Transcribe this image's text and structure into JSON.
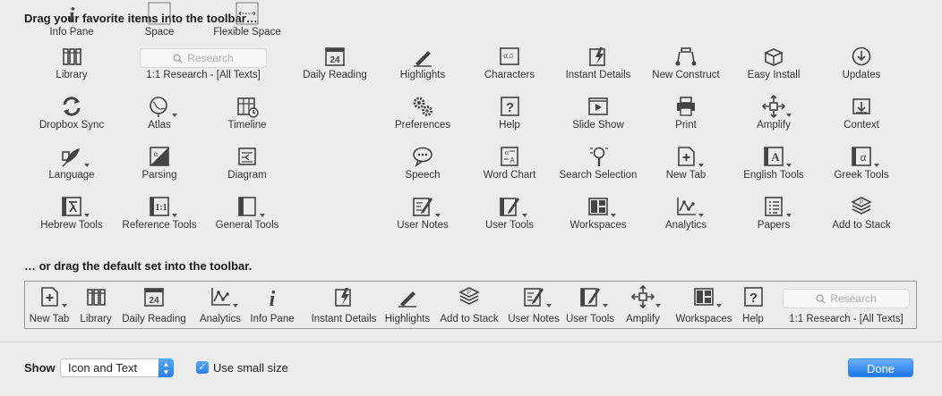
{
  "customize": {
    "heading": "Drag your favorite items into the toolbar…",
    "default_heading": "… or drag the default set into the toolbar."
  },
  "items": [
    {
      "label": "Library",
      "icon": "library-icon"
    },
    {
      "label": "1:1 Research - [All Texts]",
      "icon": "search-field",
      "placeholder": "Research"
    },
    {
      "label": "Daily Reading",
      "icon": "calendar-icon",
      "calendar_day": "24"
    },
    {
      "label": "Highlights",
      "icon": "highlighter-icon"
    },
    {
      "label": "Characters",
      "icon": "characters-icon"
    },
    {
      "label": "Instant Details",
      "icon": "lightning-icon"
    },
    {
      "label": "New Construct",
      "icon": "construct-icon"
    },
    {
      "label": "Easy Install",
      "icon": "box-icon"
    },
    {
      "label": "Updates",
      "icon": "download-icon"
    },
    {
      "label": "Dropbox Sync",
      "icon": "sync-icon"
    },
    {
      "label": "Atlas",
      "icon": "globe-icon"
    },
    {
      "label": "Timeline",
      "icon": "timeline-icon"
    },
    {
      "label": "Preferences",
      "icon": "gears-icon"
    },
    {
      "label": "Help",
      "icon": "help-icon"
    },
    {
      "label": "Slide Show",
      "icon": "slideshow-icon"
    },
    {
      "label": "Print",
      "icon": "printer-icon"
    },
    {
      "label": "Amplify",
      "icon": "amplify-icon"
    },
    {
      "label": "Context",
      "icon": "context-icon"
    },
    {
      "label": "Language",
      "icon": "quill-icon"
    },
    {
      "label": "Parsing",
      "icon": "parsing-icon"
    },
    {
      "label": "Diagram",
      "icon": "diagram-icon"
    },
    {
      "label": "Speech",
      "icon": "speech-icon"
    },
    {
      "label": "Word Chart",
      "icon": "word-chart-icon"
    },
    {
      "label": "Search Selection",
      "icon": "search-selection-icon"
    },
    {
      "label": "New Tab",
      "icon": "new-tab-icon"
    },
    {
      "label": "English Tools",
      "icon": "english-tools-icon"
    },
    {
      "label": "Greek Tools",
      "icon": "greek-tools-icon"
    },
    {
      "label": "Hebrew Tools",
      "icon": "hebrew-tools-icon"
    },
    {
      "label": "Reference Tools",
      "icon": "reference-tools-icon"
    },
    {
      "label": "General Tools",
      "icon": "general-tools-icon"
    },
    {
      "label": "User Notes",
      "icon": "user-notes-icon"
    },
    {
      "label": "User Tools",
      "icon": "user-tools-icon"
    },
    {
      "label": "Workspaces",
      "icon": "workspaces-icon"
    },
    {
      "label": "Analytics",
      "icon": "analytics-icon"
    },
    {
      "label": "Papers",
      "icon": "papers-icon"
    },
    {
      "label": "Add to Stack",
      "icon": "stack-icon"
    },
    {
      "label": "Info Pane",
      "icon": "info-icon"
    },
    {
      "label": "Space",
      "icon": "space-icon"
    },
    {
      "label": "Flexible Space",
      "icon": "flexible-space-icon"
    }
  ],
  "default_set": [
    {
      "label": "New Tab",
      "icon": "new-tab-icon"
    },
    {
      "label": "Library",
      "icon": "library-icon"
    },
    {
      "label": "Daily Reading",
      "icon": "calendar-icon"
    },
    {
      "label": "Analytics",
      "icon": "analytics-icon"
    },
    {
      "label": "Info Pane",
      "icon": "info-icon"
    },
    {
      "label": "Instant Details",
      "icon": "lightning-icon"
    },
    {
      "label": "Highlights",
      "icon": "highlighter-icon"
    },
    {
      "label": "Add to Stack",
      "icon": "stack-icon"
    },
    {
      "label": "User Notes",
      "icon": "user-notes-icon"
    },
    {
      "label": "User Tools",
      "icon": "user-tools-icon"
    },
    {
      "label": "Amplify",
      "icon": "amplify-icon"
    },
    {
      "label": "Workspaces",
      "icon": "workspaces-icon"
    },
    {
      "label": "Help",
      "icon": "help-icon"
    },
    {
      "label": "1:1 Research - [All Texts]",
      "icon": "search-field",
      "placeholder": "Research"
    }
  ],
  "footer": {
    "show_label": "Show",
    "show_value": "Icon and Text",
    "small_size_label": "Use small size",
    "small_size_checked": true,
    "done_label": "Done"
  },
  "colors": {
    "accent": "#2a7ee8",
    "icon": "#444444"
  }
}
